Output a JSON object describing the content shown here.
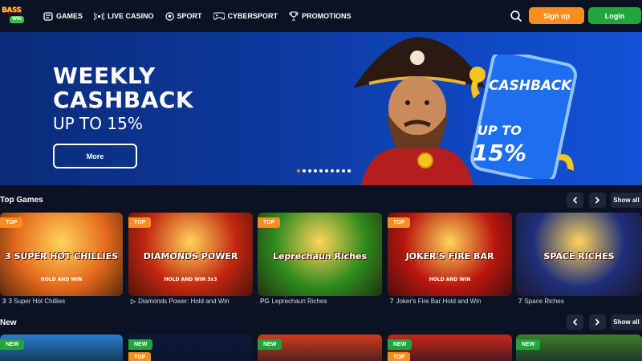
{
  "header": {
    "logo_line1": "BASS",
    "logo_line2": "WIN",
    "nav": [
      {
        "label": "GAMES",
        "icon": "games-icon"
      },
      {
        "label": "LIVE CASINO",
        "icon": "live-icon"
      },
      {
        "label": "SPORT",
        "icon": "ball-icon"
      },
      {
        "label": "CYBERSPORT",
        "icon": "gamepad-icon"
      },
      {
        "label": "PROMOTIONS",
        "icon": "trophy-icon"
      }
    ],
    "signup_label": "Sign up",
    "login_label": "Login"
  },
  "banner": {
    "title_line1": "WEEKLY",
    "title_line2": "CASHBACK",
    "subtitle": "UP TO 15%",
    "more_label": "More",
    "phone_label": "CASHBACK",
    "phone_up": "UP TO",
    "phone_pct": "15%",
    "slide_count": 10,
    "active_slide": 0
  },
  "top_games": {
    "title": "Top Games",
    "show_all": "Show all",
    "games": [
      {
        "badge": "TOP",
        "name": "3 Super Hot Chillies",
        "provider": "3",
        "art_title": "3 SUPER HOT CHILLIES",
        "art_sub": "HOLD AND WIN",
        "bg": "#e56a1c"
      },
      {
        "badge": "TOP",
        "name": "Diamonds Power: Hold and Win",
        "provider": "▷",
        "art_title": "DIAMONDS POWER",
        "art_sub": "HOLD AND WIN 3x3",
        "bg": "#c2260f"
      },
      {
        "badge": "TOP",
        "name": "Leprechaun Riches",
        "provider": "PG",
        "art_title": "Leprechaun Riches",
        "art_sub": "",
        "bg": "#2f8a1e"
      },
      {
        "badge": "TOP",
        "name": "Joker's Fire Bar Hold and Win",
        "provider": "7",
        "art_title": "JOKER'S FIRE BAR",
        "art_sub": "HOLD AND WIN",
        "bg": "#b8160f"
      },
      {
        "badge": "",
        "name": "Space Riches",
        "provider": "7",
        "art_title": "SPACE RICHES",
        "art_sub": "",
        "bg": "#1e2f7a"
      }
    ]
  },
  "new_games": {
    "title": "New",
    "show_all": "Show all",
    "games": [
      {
        "badge": "NEW",
        "badge2": "",
        "bg": "#2a7ec9"
      },
      {
        "badge": "NEW",
        "badge2": "TOP",
        "bg": "#0b1a3a"
      },
      {
        "badge": "NEW",
        "badge2": "",
        "bg": "#d23a1a"
      },
      {
        "badge": "NEW",
        "badge2": "TOP",
        "bg": "#c7261b"
      },
      {
        "badge": "NEW",
        "badge2": "",
        "bg": "#3e7d2a"
      }
    ]
  }
}
